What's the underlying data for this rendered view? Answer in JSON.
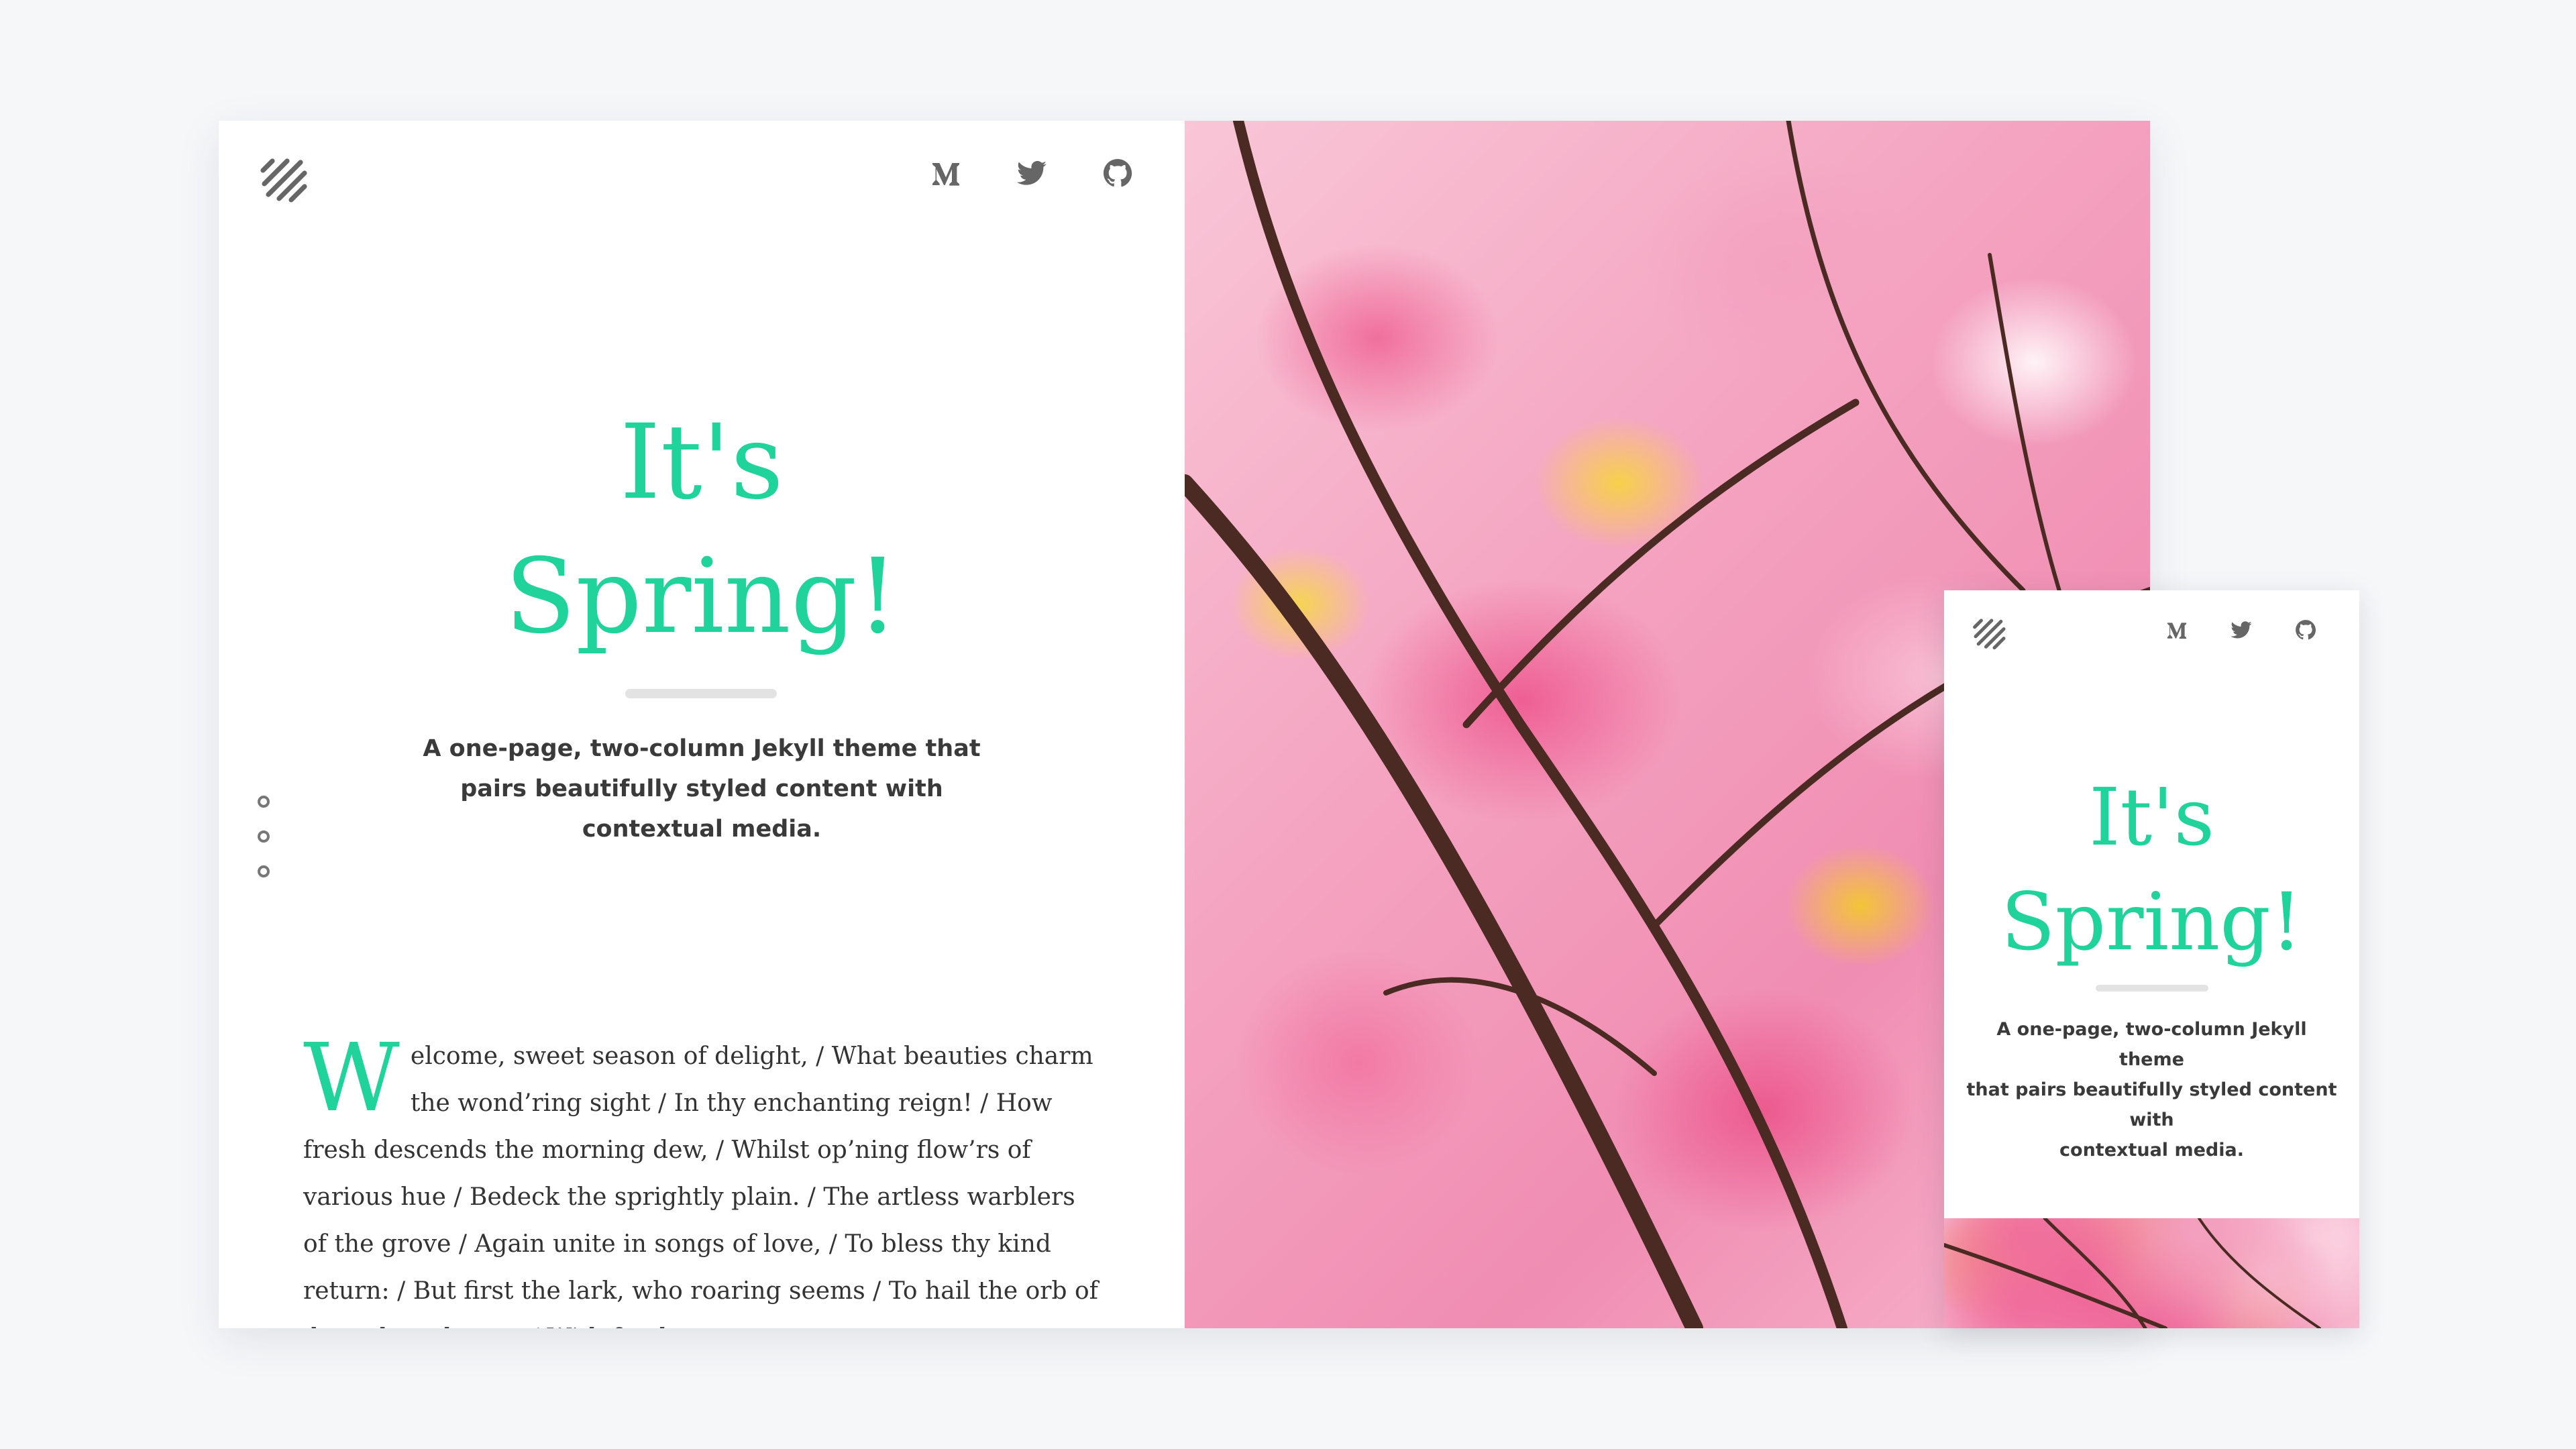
{
  "theme": {
    "accent": "#1fd39a",
    "background": "#f6f7f9",
    "text": "#333333"
  },
  "nav": {
    "logo_icon": "diagonal-stripes-logo",
    "icons": [
      "medium-icon",
      "twitter-icon",
      "github-icon"
    ]
  },
  "hero": {
    "title_line1": "It's",
    "title_line2": "Spring!",
    "tagline_line1": "A one-page, two-column Jekyll theme that",
    "tagline_line2": "pairs beautifully styled content with",
    "tagline_line3": "contextual media."
  },
  "mobile_hero": {
    "tagline_line1": "A one-page, two-column Jekyll theme",
    "tagline_line2": "that pairs beautifully styled content with",
    "tagline_line3": "contextual media."
  },
  "section_dots": 3,
  "poem": {
    "dropcap": "W",
    "text": "elcome, sweet season of delight, / What beauties charm the wond’ring sight / In thy enchanting reign! / How fresh descends the morning dew, / Whilst op’ning flow’rs of various hue / Bedeck the sprightly plain. / The artless warblers of the grove / Again unite in songs of love, / To bless thy kind return: / But first the lark, who roaring seems / To hail the orb of day, whose beams / With fresh"
  },
  "media": {
    "image": "pink cherry blossoms with yellow leaves"
  }
}
